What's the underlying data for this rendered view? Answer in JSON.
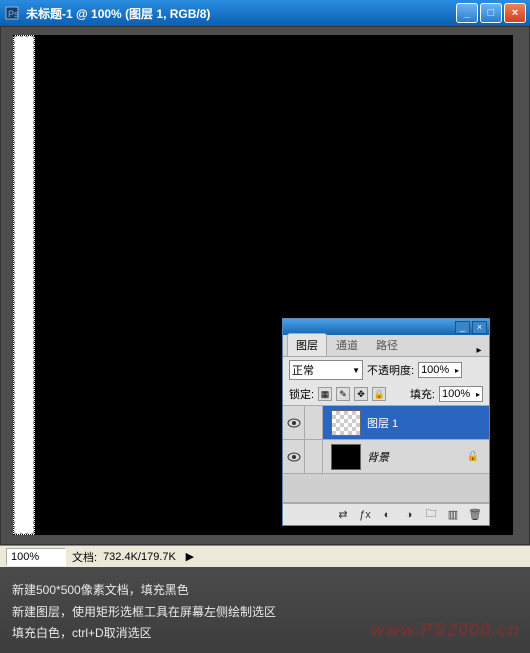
{
  "window": {
    "title": "未标题-1 @ 100% (图层 1, RGB/8)"
  },
  "status": {
    "zoom": "100%",
    "doc_label": "文档:",
    "doc_info": "732.4K/179.7K"
  },
  "layers_panel": {
    "tabs": {
      "layers": "图层",
      "channels": "通道",
      "paths": "路径"
    },
    "blend_mode": "正常",
    "opacity_label": "不透明度:",
    "opacity_value": "100%",
    "lock_label": "锁定:",
    "fill_label": "填充:",
    "fill_value": "100%",
    "layer1_name": "图层 1",
    "background_name": "背景"
  },
  "instructions": {
    "line1": "新建500*500像素文档，填充黑色",
    "line2": "新建图层，使用矩形选框工具在屏幕左侧绘制选区",
    "line3": "填充白色，ctrl+D取消选区"
  },
  "watermark": "www.PS2000.cn"
}
